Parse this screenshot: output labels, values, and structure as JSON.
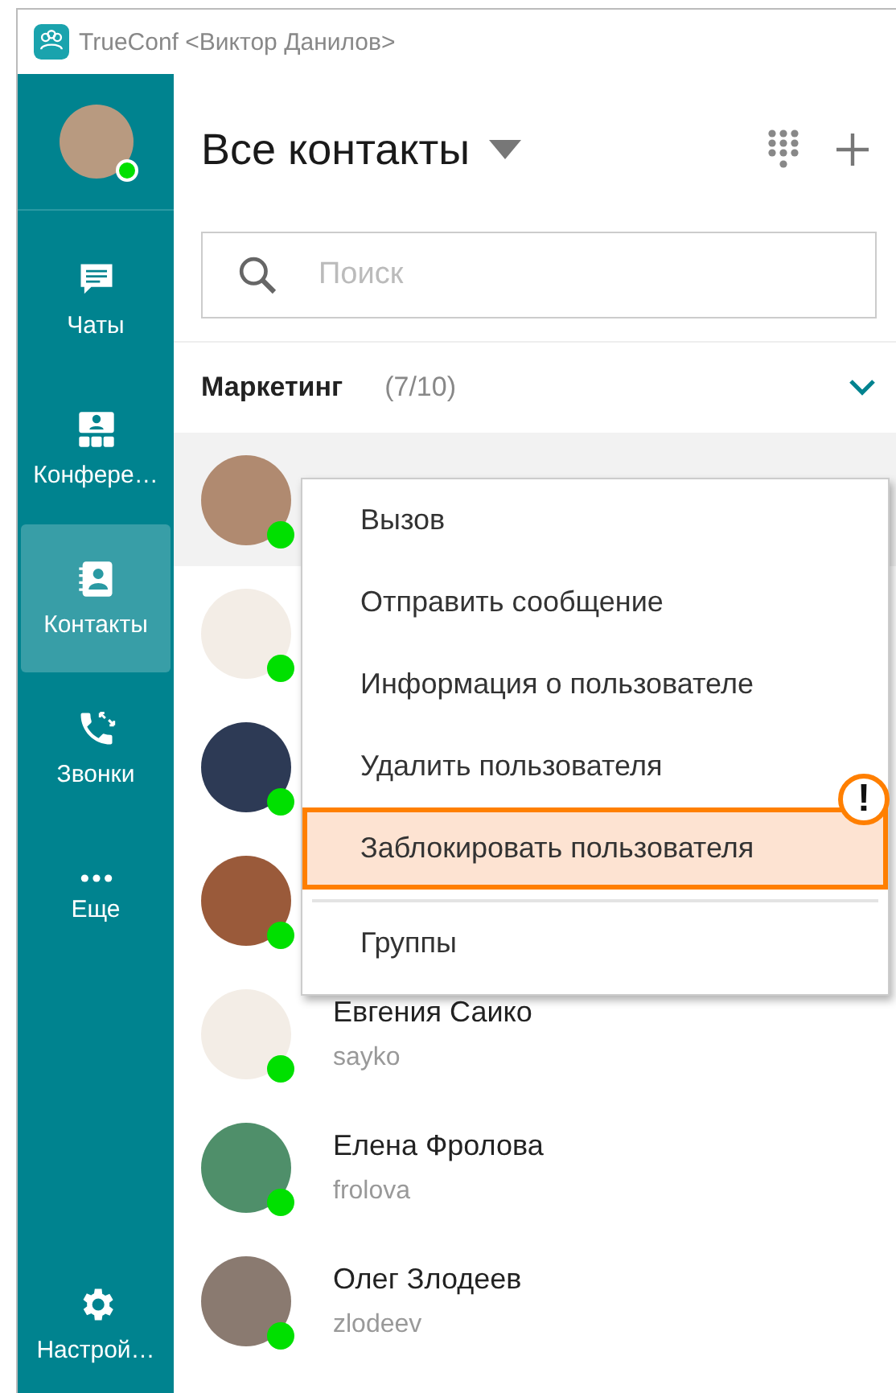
{
  "window": {
    "title": "TrueConf <Виктор Данилов>"
  },
  "sidebar": {
    "user": {
      "online": true
    },
    "items": [
      {
        "kind": "chats",
        "label": "Чаты",
        "selected": false
      },
      {
        "kind": "conferences",
        "label": "Конфере…",
        "selected": false
      },
      {
        "kind": "contacts",
        "label": "Контакты",
        "selected": true
      },
      {
        "kind": "calls",
        "label": "Звонки",
        "selected": false
      },
      {
        "kind": "more",
        "label": "Еще",
        "selected": false
      }
    ],
    "settings": {
      "label": "Настрой…"
    }
  },
  "header": {
    "title": "Все контакты"
  },
  "search": {
    "placeholder": "Поиск"
  },
  "group": {
    "name": "Маркетинг",
    "count": "(7/10)",
    "expanded": true
  },
  "contacts": [
    {
      "online": true,
      "selected": true
    },
    {
      "online": true,
      "selected": false
    },
    {
      "online": true,
      "selected": false
    },
    {
      "online": true,
      "selected": false
    },
    {
      "name": "Евгения Саико",
      "login": "sayko",
      "online": true,
      "selected": false
    },
    {
      "name": "Елена Фролова",
      "login": "frolova",
      "online": true,
      "selected": false
    },
    {
      "name": "Олег Злодеев",
      "login": "zlodeev",
      "online": true,
      "selected": false
    }
  ],
  "context_menu": {
    "badge": "!",
    "items": [
      {
        "label": "Вызов",
        "highlighted": false,
        "divider_before": false
      },
      {
        "label": "Отправить сообщение",
        "highlighted": false,
        "divider_before": false
      },
      {
        "label": "Информация о пользователе",
        "highlighted": false,
        "divider_before": false
      },
      {
        "label": "Удалить пользователя",
        "highlighted": false,
        "divider_before": false
      },
      {
        "label": "Заблокировать пользователя",
        "highlighted": true,
        "divider_before": false
      },
      {
        "label": "Группы",
        "highlighted": false,
        "divider_before": true
      }
    ]
  }
}
